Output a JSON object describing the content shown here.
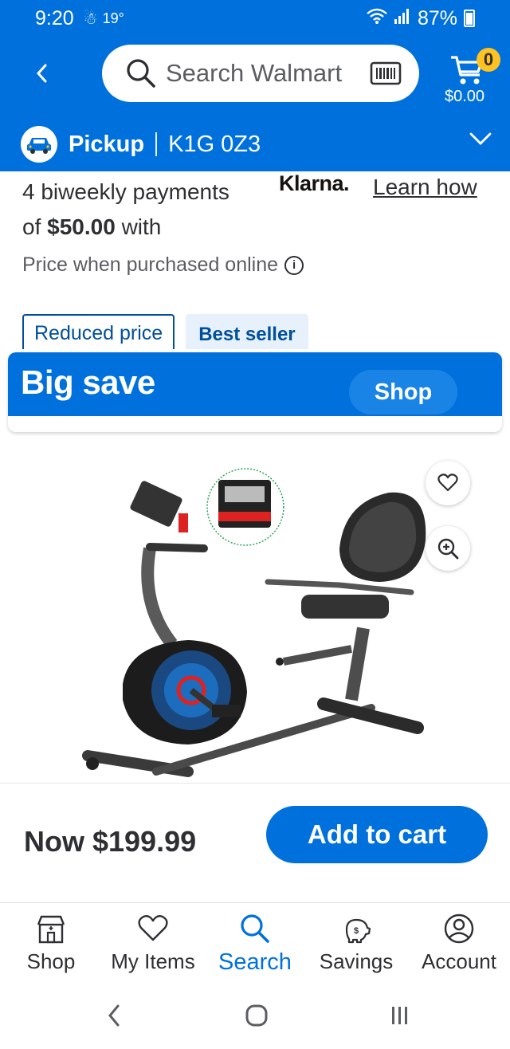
{
  "status": {
    "time": "9:20",
    "temperature": "19°",
    "battery": "87%"
  },
  "search": {
    "placeholder": "Search Walmart"
  },
  "cart": {
    "count": "0",
    "total": "$0.00"
  },
  "pickup": {
    "label": "Pickup",
    "postal_code": "K1G 0Z3"
  },
  "klarna": {
    "text_before": "4 biweekly payments",
    "text_of": "of",
    "amount": "$50.00",
    "text_with": "with",
    "logo": "Klarna.",
    "learn_link": "Learn how"
  },
  "price_note": "Price when purchased online",
  "tags": {
    "reduced": "Reduced price",
    "best_seller": "Best seller"
  },
  "promo": {
    "title": "Big save",
    "button": "Shop"
  },
  "product": {
    "image": "recumbent-exercise-bike-image"
  },
  "buy": {
    "price": "Now $199.99",
    "add_to_cart": "Add to cart"
  },
  "tabs": [
    {
      "label": "Shop",
      "icon": "store-icon"
    },
    {
      "label": "My Items",
      "icon": "heart-icon"
    },
    {
      "label": "Search",
      "icon": "search-icon",
      "active": true
    },
    {
      "label": "Savings",
      "icon": "piggy-bank-icon"
    },
    {
      "label": "Account",
      "icon": "account-icon"
    }
  ],
  "colors": {
    "brand_blue": "#0071dc",
    "badge_yellow": "#ffc220",
    "tag_blue": "#004f9a"
  }
}
